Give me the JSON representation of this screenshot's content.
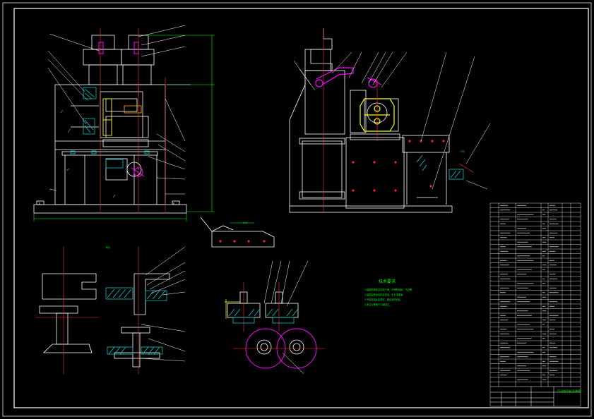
{
  "drawing": {
    "background": "#000000",
    "colors": {
      "line": "#ffffff",
      "hatch": "#00c8c8",
      "highlight": "#ff00ff",
      "dimension": "#00ff00",
      "center": "#ff2020",
      "yellow": "#ffff00",
      "title_text": "#00ff00"
    }
  },
  "tech_requirements": {
    "title": "技术要求",
    "lines": [
      "1.装配前零件应清洗干净，不得有毛刺、飞边等。",
      "2.装配后各运动件应灵活，无卡滞现象。",
      "3.气缸安装后应调试，保证动作可靠。",
      "4.未注公差按IT12级加工。"
    ]
  },
  "views": {
    "front_label": "A-A",
    "detail_label": "B向",
    "side_label": "C向"
  },
  "title_block": {
    "name": "气动冲压机总装图"
  }
}
